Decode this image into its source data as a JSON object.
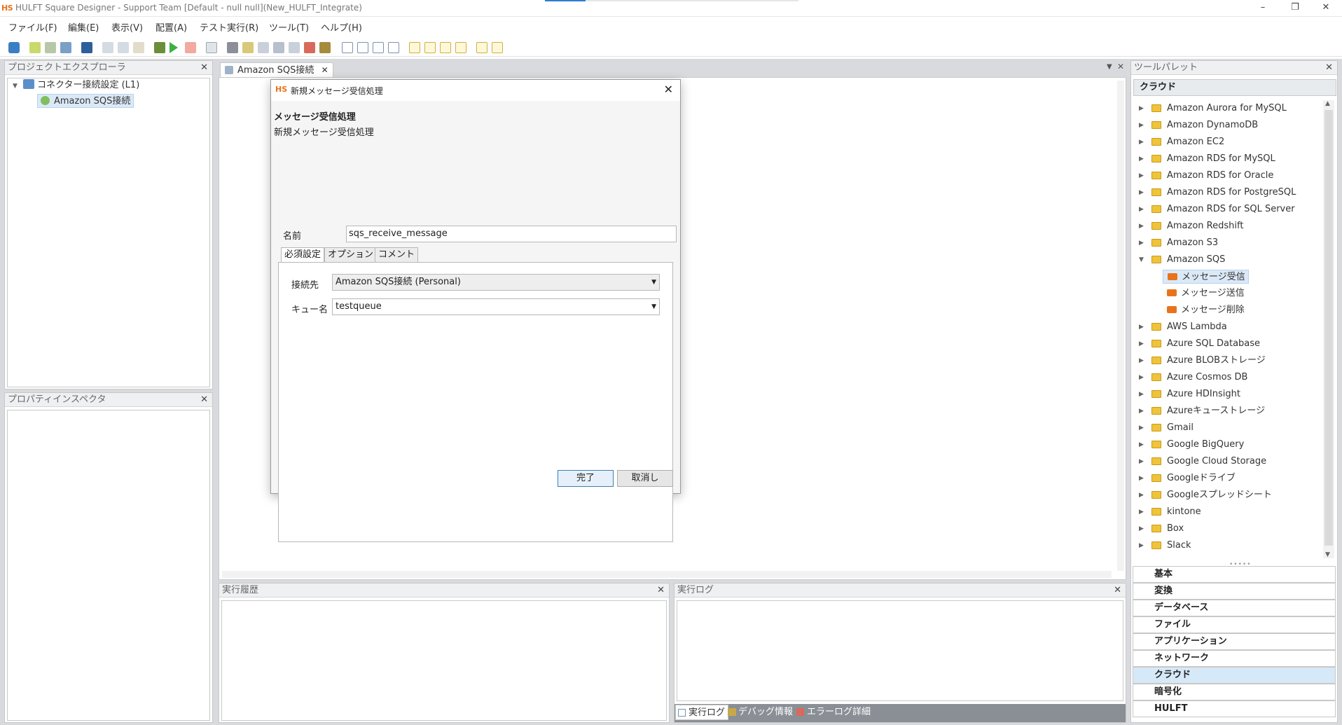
{
  "window": {
    "logo": "HS",
    "title": "HULFT Square Designer - Support Team [Default - null null](New_HULFT_Integrate)",
    "progress": 0.16
  },
  "menu": [
    "ファイル(F)",
    "編集(E)",
    "表示(V)",
    "配置(A)",
    "テスト実行(R)",
    "ツール(T)",
    "ヘルプ(H)"
  ],
  "project_explorer": {
    "header": "プロジェクトエクスプローラ",
    "root": "コネクター接続設定 (L1)",
    "child": "Amazon SQS接続"
  },
  "property_inspector": {
    "header": "プロパティインスペクタ"
  },
  "editor": {
    "tab_label": "Amazon SQS接続"
  },
  "dialog": {
    "logo": "HS",
    "window_title": "新規メッセージ受信処理",
    "heading": "メッセージ受信処理",
    "subheading": "新規メッセージ受信処理",
    "name_label": "名前",
    "name_value": "sqs_receive_message",
    "tabs": [
      "必須設定",
      "オプション",
      "コメント"
    ],
    "connection_label": "接続先",
    "connection_value": "Amazon SQS接続 (Personal)",
    "queue_label": "キュー名",
    "queue_value": "testqueue",
    "ok_label": "完了",
    "cancel_label": "取消し"
  },
  "exec_history": {
    "header": "実行履歴"
  },
  "exec_log": {
    "header": "実行ログ",
    "tabs": [
      "実行ログ",
      "デバッグ情報",
      "エラーログ詳細"
    ]
  },
  "palette": {
    "header": "ツールパレット",
    "section": "クラウド",
    "items": [
      "Amazon Aurora for MySQL",
      "Amazon DynamoDB",
      "Amazon EC2",
      "Amazon RDS for MySQL",
      "Amazon RDS for Oracle",
      "Amazon RDS for PostgreSQL",
      "Amazon RDS for SQL Server",
      "Amazon Redshift",
      "Amazon S3",
      "Amazon SQS"
    ],
    "sqs_children": [
      "メッセージ受信",
      "メッセージ送信",
      "メッセージ削除"
    ],
    "items_after": [
      "AWS Lambda",
      "Azure SQL Database",
      "Azure BLOBストレージ",
      "Azure Cosmos DB",
      "Azure HDInsight",
      "Azureキューストレージ",
      "Gmail",
      "Google BigQuery",
      "Google Cloud Storage",
      "Googleドライブ",
      "Googleスプレッドシート",
      "kintone",
      "Box",
      "Slack"
    ],
    "categories": [
      "基本",
      "変換",
      "データベース",
      "ファイル",
      "アプリケーション",
      "ネットワーク",
      "クラウド",
      "暗号化",
      "HULFT"
    ],
    "active_category": "クラウド"
  }
}
